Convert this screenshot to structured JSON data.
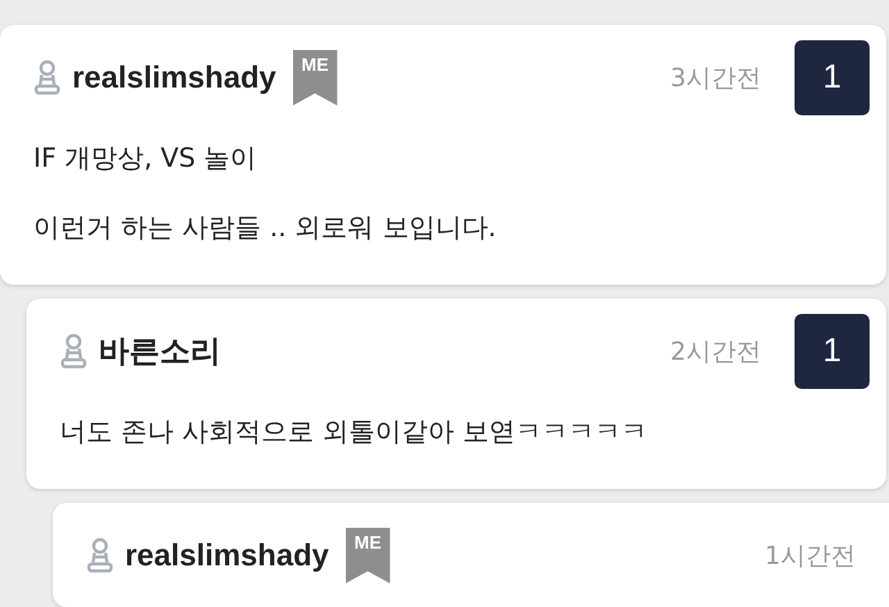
{
  "comments": [
    {
      "author": "realslimshady",
      "me_badge": "ME",
      "time": "3시간전",
      "count": "1",
      "lines": [
        "IF 개망상, VS 놀이",
        "이런거 하는 사람들 .. 외로워 보입니다."
      ],
      "children": [
        {
          "author": "바른소리",
          "time": "2시간전",
          "count": "1",
          "lines": [
            "너도 존나 사회적으로 외톨이같아 보엳ㅋㅋㅋㅋㅋ"
          ],
          "children": [
            {
              "author": "realslimshady",
              "me_badge": "ME",
              "time": "1시간전"
            }
          ]
        }
      ]
    }
  ]
}
